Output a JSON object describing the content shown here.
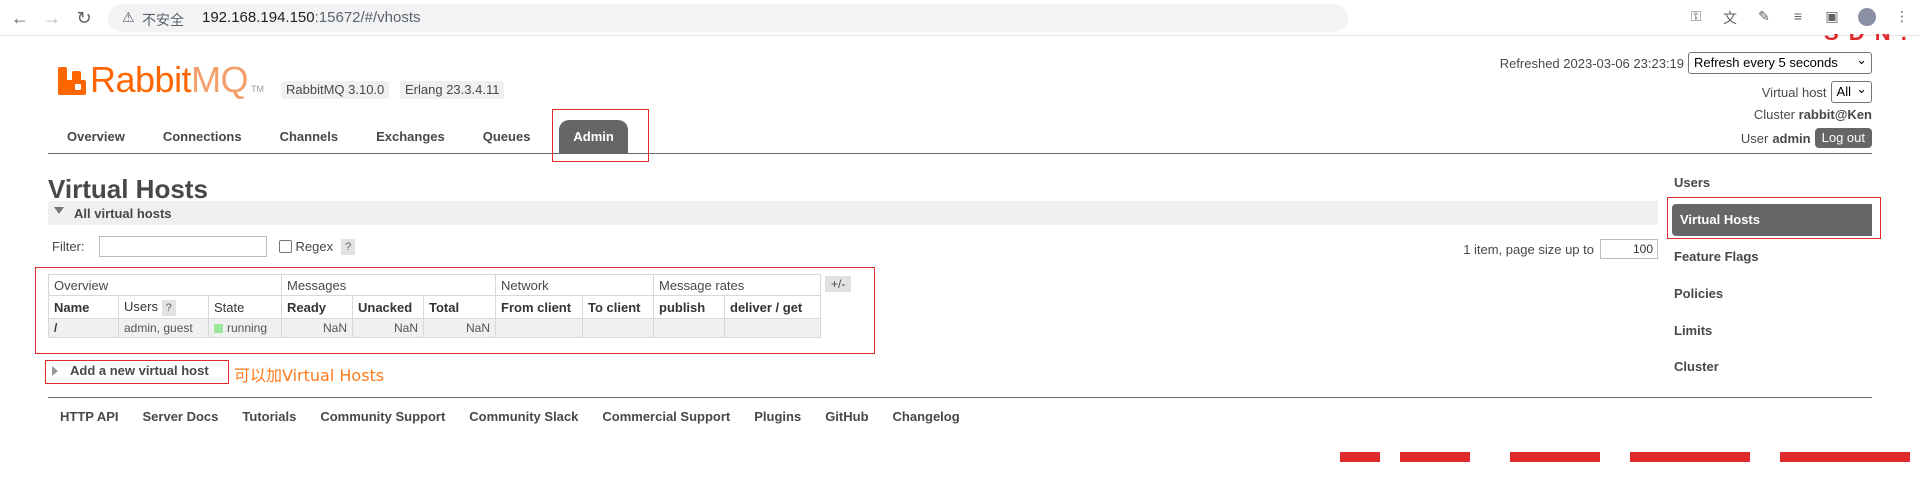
{
  "browser": {
    "insecure_label": "不安全",
    "url_host": "192.168.194.150",
    "url_rest": ":15672/#/vhosts",
    "icons": [
      "back-icon",
      "forward-icon",
      "reload-icon",
      "warning-icon",
      "key-icon",
      "translate-icon",
      "extension-icon",
      "reading-list-icon",
      "sidepanel-icon",
      "profile-icon",
      "menu-icon"
    ]
  },
  "header": {
    "logo_text_a": "Rabbit",
    "logo_text_b": "MQ",
    "logo_tm": "TM",
    "version": "RabbitMQ 3.10.0",
    "erlang": "Erlang 23.3.4.11",
    "refreshed_label": "Refreshed 2023-03-06 23:23:19",
    "refresh_option": "Refresh every 5 seconds",
    "vhost_label": "Virtual host",
    "vhost_value": "All",
    "cluster_label": "Cluster",
    "cluster_value": "rabbit@Ken",
    "user_label": "User",
    "user_value": "admin",
    "logout_label": "Log out"
  },
  "tabs": [
    {
      "label": "Overview"
    },
    {
      "label": "Connections"
    },
    {
      "label": "Channels"
    },
    {
      "label": "Exchanges"
    },
    {
      "label": "Queues"
    },
    {
      "label": "Admin",
      "active": true
    }
  ],
  "page": {
    "title": "Virtual Hosts",
    "section_label": "All virtual hosts",
    "filter_label": "Filter:",
    "regex_label": "Regex",
    "help_label": "?",
    "paging_label": "1 item, page size up to",
    "page_size": "100",
    "plusminus_label": "+/-",
    "add_label": "Add a new virtual host",
    "annotation": "可以加Virtual Hosts"
  },
  "table": {
    "groups": [
      "Overview",
      "Messages",
      "Network",
      "Message rates"
    ],
    "headers": [
      "Name",
      "Users",
      "State",
      "Ready",
      "Unacked",
      "Total",
      "From client",
      "To client",
      "publish",
      "deliver / get"
    ],
    "users_help": "?",
    "rows": [
      {
        "name": "/",
        "users": "admin, guest",
        "state": "running",
        "ready": "NaN",
        "unacked": "NaN",
        "total": "NaN",
        "from_client": "",
        "to_client": "",
        "publish": "",
        "deliver_get": ""
      }
    ]
  },
  "sidebar": {
    "items": [
      {
        "label": "Users"
      },
      {
        "label": "Virtual Hosts",
        "active": true
      },
      {
        "label": "Feature Flags"
      },
      {
        "label": "Policies"
      },
      {
        "label": "Limits"
      },
      {
        "label": "Cluster"
      }
    ]
  },
  "footer": {
    "links": [
      "HTTP API",
      "Server Docs",
      "Tutorials",
      "Community Support",
      "Community Slack",
      "Commercial Support",
      "Plugins",
      "GitHub",
      "Changelog"
    ]
  },
  "colors": {
    "brand": "#ff6600",
    "active_tab": "#666666",
    "highlight": "#e0292b",
    "annotation": "#ff7a1a",
    "running": "#9be89b"
  }
}
